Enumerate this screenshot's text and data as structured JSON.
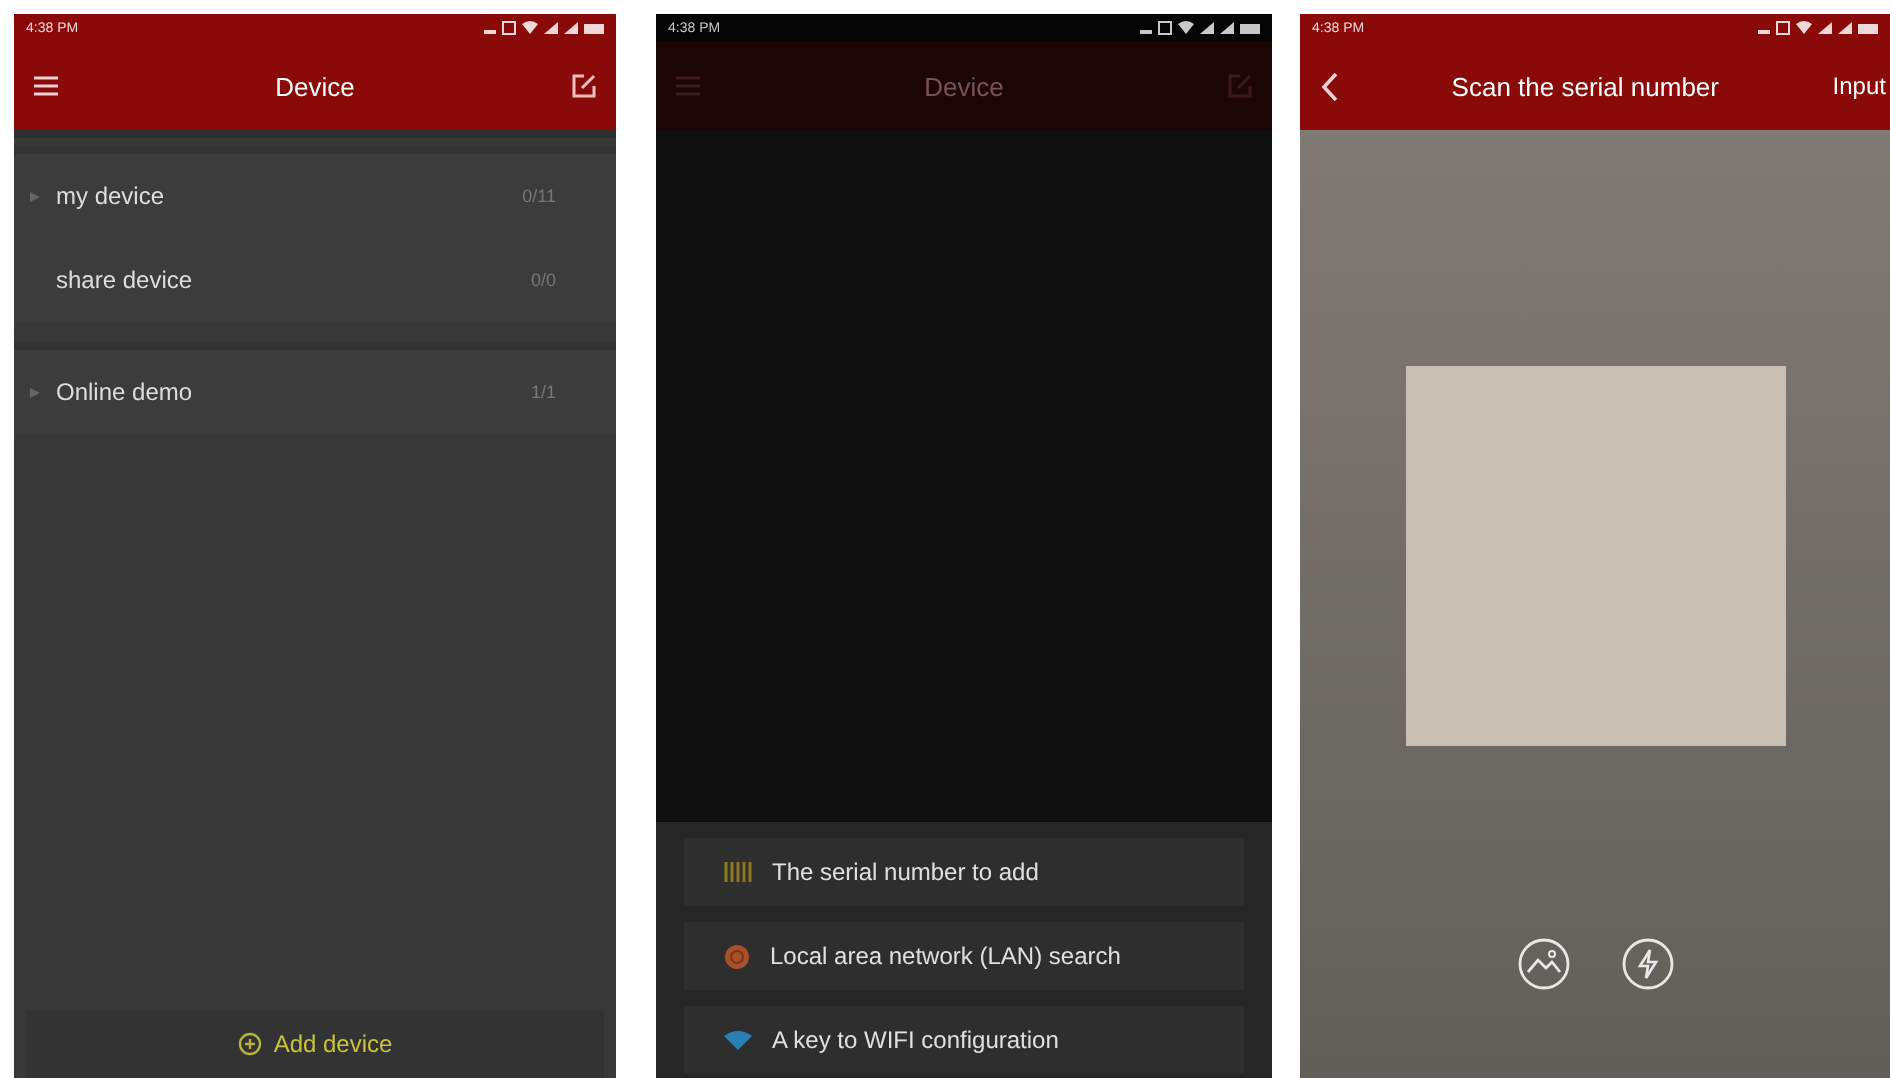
{
  "screens": [
    {
      "kind": "device_list",
      "status_time": "4:38 PM",
      "title": "Device",
      "sections": [
        [
          {
            "kind": "group",
            "label": "my device",
            "count": "0/11"
          },
          {
            "kind": "item",
            "label": "share device",
            "count": "0/0"
          }
        ],
        [
          {
            "kind": "group",
            "label": "Online demo",
            "count": "1/1"
          }
        ]
      ],
      "add_button": "Add device"
    },
    {
      "kind": "add_menu",
      "status_time": "4:38 PM",
      "title": "Device",
      "options": [
        {
          "kind": "serial",
          "label": "The serial number to add"
        },
        {
          "kind": "lan",
          "label": "Local area network (LAN) search"
        },
        {
          "kind": "wifi",
          "label": "A key to WIFI configuration"
        }
      ]
    },
    {
      "kind": "scanner",
      "status_time": "4:38 PM",
      "title": "Scan the serial number",
      "action": "Input"
    }
  ]
}
